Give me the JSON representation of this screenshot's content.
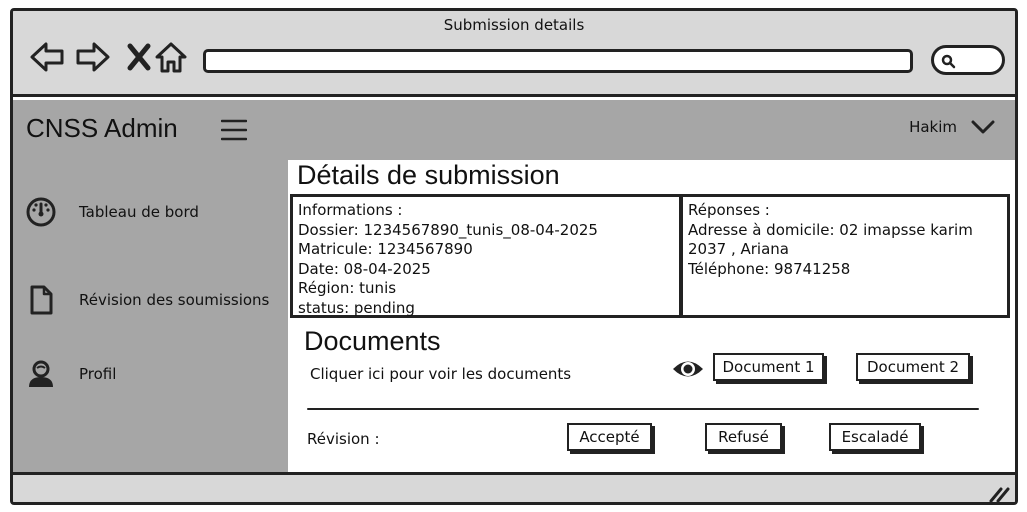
{
  "window": {
    "title": "Submission details"
  },
  "header": {
    "brand": "CNSS Admin",
    "user_name": "Hakim"
  },
  "sidebar": {
    "items": [
      {
        "label": "Tableau de bord",
        "icon": "dashboard-gauge-icon"
      },
      {
        "label": "Révision des soumissions",
        "icon": "document-icon"
      },
      {
        "label": "Profil",
        "icon": "user-profile-icon"
      }
    ]
  },
  "main": {
    "title": "Détails de submission",
    "informations": {
      "heading": "Informations  :",
      "lines": [
        "Dossier: 1234567890_tunis_08-04-2025",
        "Matricule: 1234567890",
        "Date: 08-04-2025",
        "Région: tunis",
        "status: pending"
      ]
    },
    "reponses": {
      "heading": " Réponses  :",
      "lines": [
        "Adresse à domicile: 02 imapsse karim",
        "2037 , Ariana",
        "Téléphone: 98741258"
      ]
    },
    "documents": {
      "title": "Documents",
      "hint": "Cliquer ici pour voir les documents",
      "buttons": [
        "Document 1",
        "Document 2"
      ]
    },
    "revision": {
      "label": "Révision :",
      "buttons": [
        "Accepté",
        "Refusé",
        "Escaladé"
      ]
    }
  }
}
